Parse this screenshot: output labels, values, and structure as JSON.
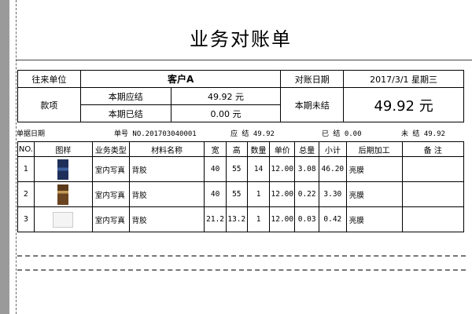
{
  "title": "业务对账单",
  "header": {
    "client_label": "往来单位",
    "client_value": "客户A",
    "date_label": "对账日期",
    "date_value": "2017/3/1 星期三",
    "item_label": "款项",
    "due_label": "本期应结",
    "due_value": "49.92 元",
    "settled_label": "本期已结",
    "settled_value": "0.00 元",
    "unsettled_label": "本期未结",
    "unsettled_value": "49.92 元"
  },
  "summary": {
    "doc_date_label": "单据日期",
    "doc_no": "单号 NO.201703040001",
    "due": "应 结 49.92",
    "settled": "已 结 0.00",
    "unsettled": "未 结 49.92"
  },
  "table": {
    "columns": [
      "NO.",
      "图样",
      "业务类型",
      "材料名称",
      "宽",
      "高",
      "数量",
      "单价",
      "总量",
      "小计",
      "后期加工",
      "备 注"
    ],
    "rows": [
      {
        "no": "1",
        "type": "室内写真",
        "material": "背胶",
        "width": "40",
        "height": "55",
        "qty": "14",
        "price": "12.00",
        "total": "3.08",
        "subtotal": "46.20",
        "post": "亮膜",
        "note": ""
      },
      {
        "no": "2",
        "type": "室内写真",
        "material": "背胶",
        "width": "40",
        "height": "55",
        "qty": "1",
        "price": "12.00",
        "total": "0.22",
        "subtotal": "3.30",
        "post": "亮膜",
        "note": ""
      },
      {
        "no": "3",
        "type": "室内写真",
        "material": "背胶",
        "width": "21.2",
        "height": "13.2",
        "qty": "1",
        "price": "12.00",
        "total": "0.03",
        "subtotal": "0.42",
        "post": "亮膜",
        "note": ""
      }
    ]
  }
}
